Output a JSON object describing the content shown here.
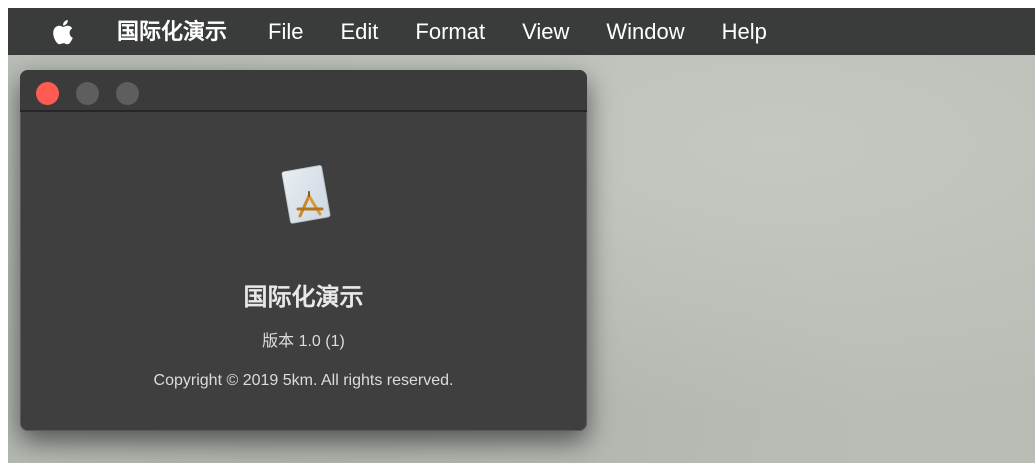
{
  "menubar": {
    "apple_icon": "apple-logo",
    "app_name": "国际化演示",
    "items": [
      {
        "label": "File"
      },
      {
        "label": "Edit"
      },
      {
        "label": "Format"
      },
      {
        "label": "View"
      },
      {
        "label": "Window"
      },
      {
        "label": "Help"
      }
    ]
  },
  "about_window": {
    "traffic_lights": {
      "close_color": "#ff5b52",
      "inactive_color": "#5e5e5e"
    },
    "app_icon": "document-app-icon",
    "app_name": "国际化演示",
    "version": "版本 1.0 (1)",
    "copyright": "Copyright © 2019 5km. All rights reserved."
  }
}
